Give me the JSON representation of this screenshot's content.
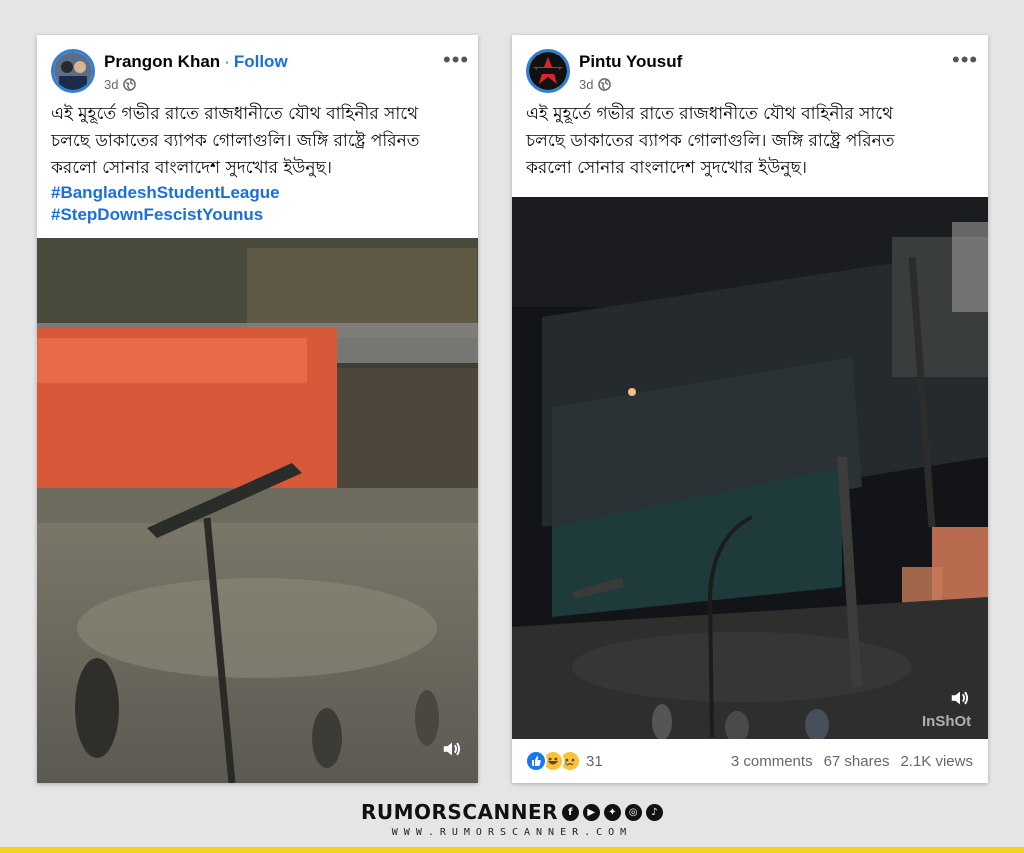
{
  "post1": {
    "author": "Prangon Khan",
    "separator": "·",
    "follow": "Follow",
    "time": "3d",
    "text_lines": [
      "এই মুহূর্তে গভীর রাতে রাজধানীতে যৌথ বাহিনীর সাথে",
      "চলছে ডাকাতের ব্যাপক গোলাগুলি। জঙ্গি রাষ্ট্রে পরিনত",
      "করলো সোনার বাংলাদেশ সুদখোর ইউনুছ।"
    ],
    "hashtags": [
      "#BangladeshStudentLeague",
      "#StepDownFescistYounus"
    ]
  },
  "post2": {
    "author": "Pintu Yousuf",
    "time": "3d",
    "text_lines": [
      "এই মুহূর্তে গভীর রাতে রাজধানীতে যৌথ বাহিনীর সাথে",
      "চলছে ডাকাতের ব্যাপক গোলাগুলি। জঙ্গি রাষ্ট্রে পরিনত",
      "করলো সোনার বাংলাদেশ সুদখোর ইউনুছ।"
    ],
    "watermark": "InShOt",
    "reactions_count": "31",
    "comments": "3 comments",
    "shares": "67 shares",
    "views": "2.1K views"
  },
  "brand": {
    "name": "RUMORSCANNER",
    "url": "WWW.RUMORSCANNER.COM",
    "accent_color": "#f4d21a"
  },
  "icons": [
    "globe-icon",
    "more-icon",
    "volume-icon",
    "like-icon",
    "haha-icon",
    "sad-icon",
    "facebook-icon",
    "youtube-icon",
    "twitter-icon",
    "instagram-icon",
    "tiktok-icon"
  ]
}
